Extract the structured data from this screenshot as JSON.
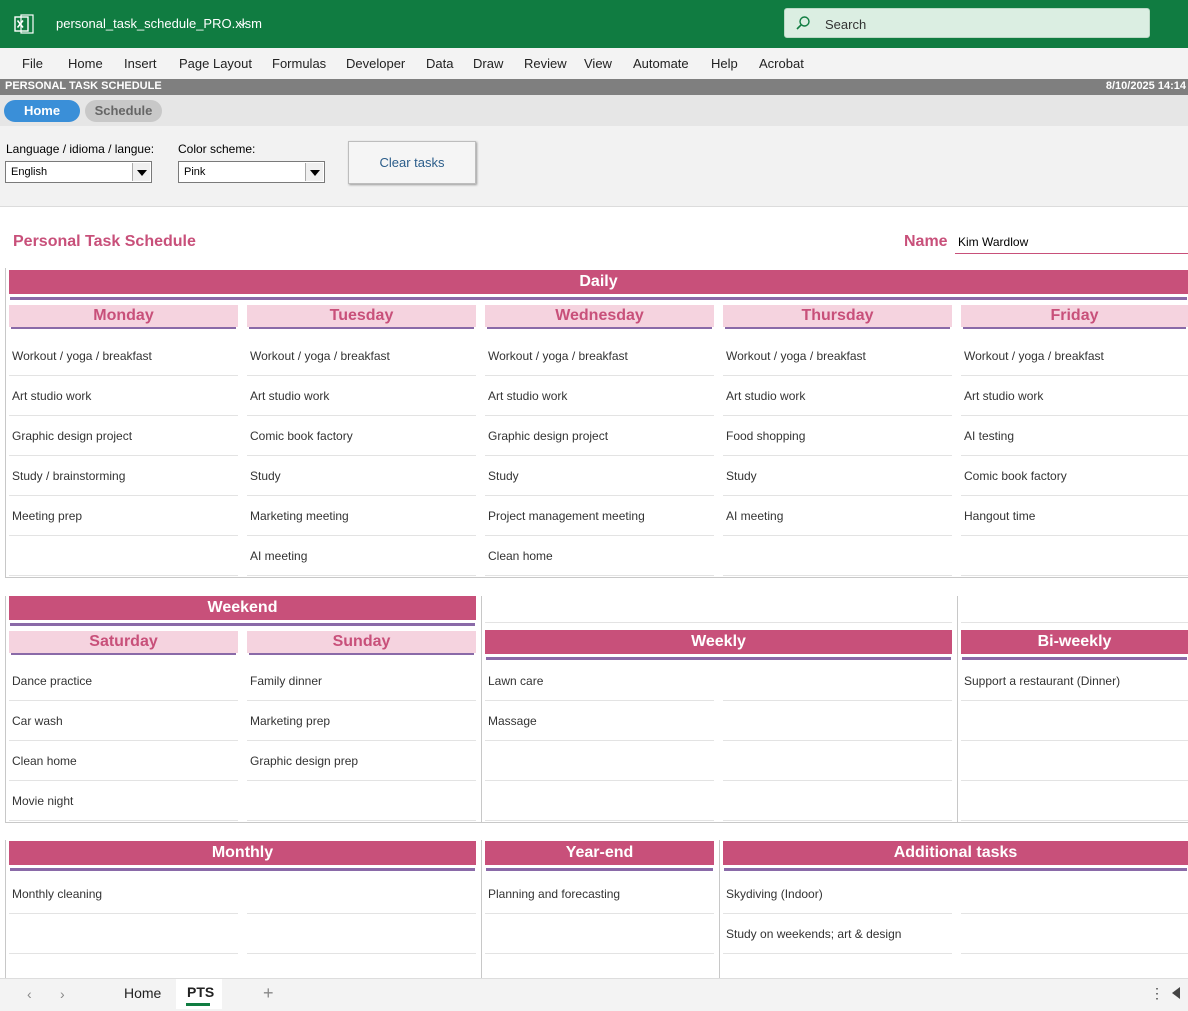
{
  "app": {
    "filename": "personal_task_schedule_PRO.xlsm",
    "search_placeholder": "Search"
  },
  "menu": [
    "File",
    "Home",
    "Insert",
    "Page Layout",
    "Formulas",
    "Developer",
    "Data",
    "Draw",
    "Review",
    "View",
    "Automate",
    "Help",
    "Acrobat"
  ],
  "sheet_header": {
    "title": "PERSONAL TASK SCHEDULE",
    "datetime": "8/10/2025 14:14"
  },
  "nav": {
    "home": "Home",
    "schedule": "Schedule"
  },
  "controls": {
    "language_label": "Language / idioma / langue:",
    "language_value": "English",
    "color_label": "Color scheme:",
    "color_value": "Pink",
    "clear_button": "Clear tasks"
  },
  "page": {
    "title": "Personal Task Schedule",
    "name_label": "Name",
    "name_value": "Kim Wardlow"
  },
  "daily": {
    "title": "Daily",
    "days": [
      {
        "name": "Monday",
        "tasks": [
          "Workout / yoga / breakfast",
          "Art studio work",
          "Graphic design project",
          "Study / brainstorming",
          "Meeting prep",
          ""
        ]
      },
      {
        "name": "Tuesday",
        "tasks": [
          "Workout / yoga / breakfast",
          "Art studio work",
          "Comic book factory",
          "Study",
          "Marketing meeting",
          "AI meeting"
        ]
      },
      {
        "name": "Wednesday",
        "tasks": [
          "Workout / yoga / breakfast",
          "Art studio work",
          "Graphic design project",
          "Study",
          "Project management meeting",
          "Clean home"
        ]
      },
      {
        "name": "Thursday",
        "tasks": [
          "Workout / yoga / breakfast",
          "Art studio work",
          "Food shopping",
          "Study",
          "AI meeting",
          ""
        ]
      },
      {
        "name": "Friday",
        "tasks": [
          "Workout / yoga / breakfast",
          "Art studio work",
          "AI testing",
          "Comic book factory",
          "Hangout time",
          ""
        ]
      }
    ]
  },
  "weekend": {
    "title": "Weekend",
    "days": [
      {
        "name": "Saturday",
        "tasks": [
          "Dance practice",
          "Car wash",
          "Clean home",
          "Movie night"
        ]
      },
      {
        "name": "Sunday",
        "tasks": [
          "Family dinner",
          "Marketing prep",
          "Graphic design prep",
          ""
        ]
      }
    ]
  },
  "weekly": {
    "title": "Weekly",
    "tasks_left": [
      "Lawn care",
      "Massage",
      "",
      ""
    ],
    "tasks_right": [
      "",
      "",
      "",
      ""
    ]
  },
  "biweekly": {
    "title": "Bi-weekly",
    "tasks": [
      "Support a restaurant (Dinner)",
      "",
      "",
      ""
    ]
  },
  "monthly": {
    "title": "Monthly",
    "tasks_left": [
      "Monthly cleaning",
      "",
      ""
    ],
    "tasks_right": [
      "",
      "",
      ""
    ]
  },
  "yearend": {
    "title": "Year-end",
    "tasks": [
      "Planning and forecasting",
      "",
      ""
    ]
  },
  "additional": {
    "title": "Additional tasks",
    "tasks_left": [
      "Skydiving (Indoor)",
      "Study on weekends; art & design",
      ""
    ],
    "tasks_right": [
      "",
      "",
      ""
    ]
  },
  "tabs": {
    "home": "Home",
    "active": "PTS"
  }
}
